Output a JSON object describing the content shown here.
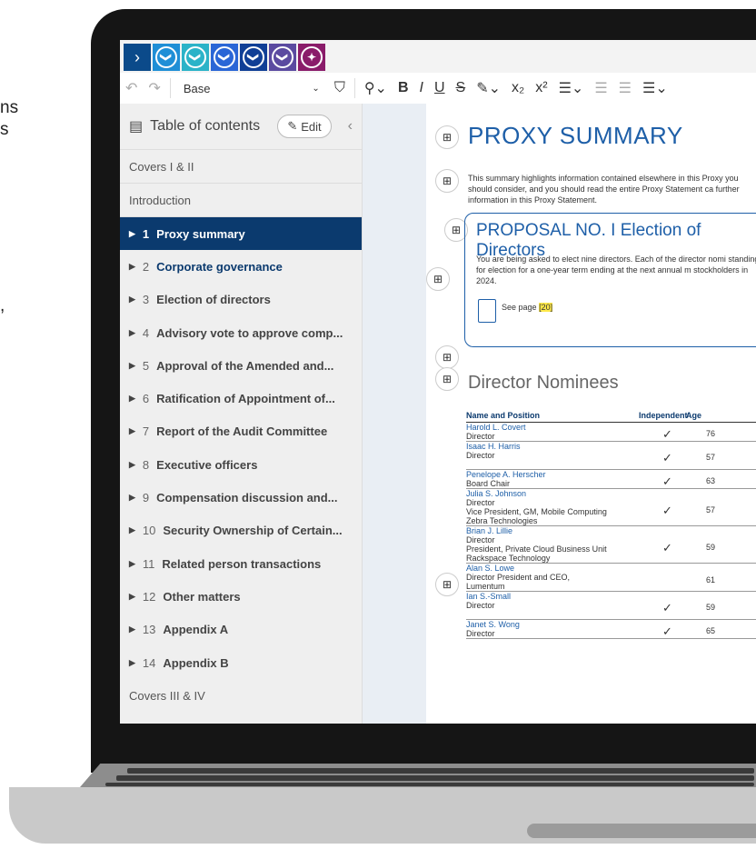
{
  "background_fragments": [
    "ns",
    "s",
    ","
  ],
  "topbar": {
    "nav_icon": "chevron-right-icon",
    "buttons": [
      {
        "icon": "chevron-down-circle-icon",
        "color": "#1f8fd6",
        "glyph": "❯"
      },
      {
        "icon": "chevron-down-circle-icon",
        "color": "#2bb3c8",
        "glyph": "❯"
      },
      {
        "icon": "chevron-down-circle-icon",
        "color": "#2a66d6",
        "glyph": "❯"
      },
      {
        "icon": "chevron-down-circle-icon",
        "color": "#103f96",
        "glyph": "❯"
      },
      {
        "icon": "chevron-down-circle-icon",
        "color": "#5b4aa0",
        "glyph": "❯"
      },
      {
        "icon": "compass-circle-icon",
        "color": "#8a1c6a",
        "glyph": "✦"
      }
    ]
  },
  "toolbar": {
    "style_value": "Base"
  },
  "sidebar": {
    "title": "Table of contents",
    "edit_label": "Edit",
    "covers_top": "Covers I & II",
    "introduction": "Introduction",
    "items": [
      {
        "num": "1",
        "label": "Proxy summary",
        "active": true
      },
      {
        "num": "2",
        "label": "Corporate governance",
        "blue": true
      },
      {
        "num": "3",
        "label": "Election of directors"
      },
      {
        "num": "4",
        "label": "Advisory vote to approve comp..."
      },
      {
        "num": "5",
        "label": "Approval of the Amended and..."
      },
      {
        "num": "6",
        "label": "Ratification of Appointment of..."
      },
      {
        "num": "7",
        "label": "Report of the Audit Committee"
      },
      {
        "num": "8",
        "label": "Executive officers"
      },
      {
        "num": "9",
        "label": "Compensation discussion and..."
      },
      {
        "num": "10",
        "label": "Security Ownership of Certain..."
      },
      {
        "num": "11",
        "label": "Related person transactions"
      },
      {
        "num": "12",
        "label": "Other matters"
      },
      {
        "num": "13",
        "label": "Appendix A"
      },
      {
        "num": "14",
        "label": "Appendix B"
      }
    ],
    "covers_bottom": "Covers III & IV"
  },
  "document": {
    "title": "PROXY SUMMARY",
    "intro": "This summary highlights information contained elsewhere in this Proxy you should consider, and you should read the entire Proxy Statement ca further information in this Proxy Statement.",
    "proposal_title": "PROPOSAL NO. I Election of Directors",
    "proposal_text": "You are being asked to elect nine directors. Each of the director nomi standing for election for a one-year term ending at the next annual m stockholders in 2024.",
    "see_page_label": "See page",
    "see_page_num": "20",
    "nominees_heading": "Director Nominees",
    "table_headers": {
      "name": "Name and Position",
      "independent": "Independent",
      "age": "Age"
    },
    "nominees": [
      {
        "name": "Harold L. Covert",
        "lines": [
          "Director"
        ],
        "independent": true,
        "age": "76"
      },
      {
        "name": "Isaac H. Harris",
        "lines": [
          "Director"
        ],
        "independent": true,
        "age": "57"
      },
      {
        "name": "Penelope A. Herscher",
        "lines": [
          "Board Chair"
        ],
        "independent": true,
        "age": "63"
      },
      {
        "name": "Julia S. Johnson",
        "lines": [
          "Director",
          "Vice President, GM, Mobile Computing",
          "Zebra Technologies"
        ],
        "independent": true,
        "age": "57"
      },
      {
        "name": "Brian J. Lillie",
        "lines": [
          "Director",
          "President, Private Cloud Business Unit",
          "Rackspace Technology"
        ],
        "independent": true,
        "age": "59"
      },
      {
        "name": "Alan S. Lowe",
        "lines": [
          "Director President and CEO,",
          "Lumentum"
        ],
        "independent": false,
        "age": "61"
      },
      {
        "name": "Ian S.-Small",
        "lines": [
          "Director"
        ],
        "independent": true,
        "age": "59"
      },
      {
        "name": "Janet S. Wong",
        "lines": [
          "Director"
        ],
        "independent": true,
        "age": "65"
      }
    ]
  }
}
